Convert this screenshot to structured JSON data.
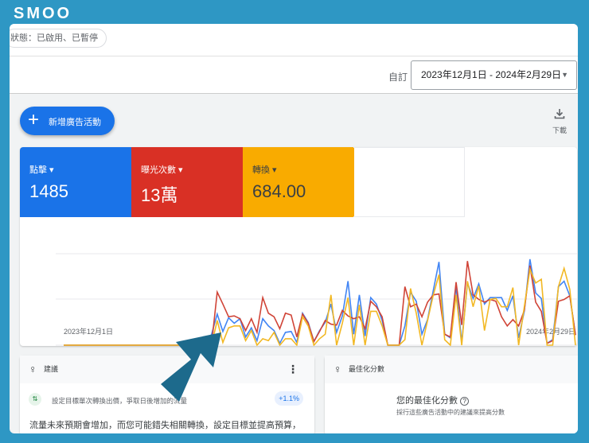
{
  "brand": "SMOO",
  "filter_chip": "狀態：已啟用、已暫停",
  "date": {
    "label": "自訂",
    "range": "2023年12月1日 - 2024年2月29日"
  },
  "new_campaign": "新增廣告活動",
  "download": "下載",
  "metrics": [
    {
      "name": "點擊",
      "value": "1485",
      "color": "#1a73e8"
    },
    {
      "name": "曝光次數",
      "value": "13萬",
      "color": "#d93025"
    },
    {
      "name": "轉換",
      "value": "684.00",
      "color": "#f9ab00"
    }
  ],
  "chart_data": {
    "type": "line",
    "x_start_label": "2023年12月1日",
    "x_end_label": "2024年2月29日",
    "days": 91,
    "ylim": [
      0,
      100
    ],
    "series": [
      {
        "name": "點擊",
        "color": "#4285f4",
        "values": [
          0,
          0,
          0,
          0,
          0,
          0,
          0,
          0,
          0,
          0,
          0,
          0,
          0,
          0,
          0,
          0,
          0,
          0,
          0,
          0,
          0,
          0,
          0,
          0,
          0,
          0,
          12,
          34,
          15,
          30,
          24,
          29,
          9,
          19,
          5,
          29,
          21,
          16,
          2,
          14,
          15,
          3,
          35,
          25,
          4,
          16,
          25,
          45,
          14,
          32,
          70,
          12,
          55,
          10,
          52,
          45,
          27,
          0,
          0,
          0,
          21,
          58,
          48,
          12,
          28,
          60,
          91,
          12,
          8,
          64,
          3,
          68,
          51,
          67,
          45,
          52,
          52,
          52,
          38,
          54,
          8,
          37,
          94,
          57,
          51,
          2,
          6,
          64,
          70,
          54,
          11
        ]
      },
      {
        "name": "曝光次數",
        "color": "#d04437",
        "values": [
          0,
          0,
          0,
          0,
          0,
          0,
          0,
          0,
          0,
          0,
          0,
          0,
          0,
          0,
          0,
          0,
          0,
          0,
          0,
          0,
          0,
          0,
          0,
          0,
          0,
          0,
          1,
          58,
          45,
          31,
          32,
          29,
          16,
          29,
          14,
          52,
          35,
          31,
          18,
          35,
          33,
          9,
          34,
          24,
          4,
          15,
          27,
          23,
          22,
          38,
          32,
          29,
          31,
          18,
          48,
          42,
          31,
          0,
          0,
          0,
          64,
          42,
          45,
          31,
          47,
          55,
          56,
          12,
          9,
          69,
          22,
          92,
          55,
          50,
          47,
          50,
          48,
          31,
          21,
          28,
          21,
          38,
          87,
          47,
          37,
          2,
          5,
          48,
          50,
          54,
          11
        ]
      },
      {
        "name": "轉換",
        "color": "#f2b824",
        "values": [
          0,
          0,
          0,
          0,
          0,
          0,
          0,
          0,
          0,
          0,
          0,
          0,
          0,
          0,
          0,
          0,
          0,
          0,
          0,
          0,
          0,
          0,
          0,
          0,
          0,
          0,
          0,
          27,
          3,
          19,
          21,
          21,
          5,
          16,
          0,
          7,
          5,
          14,
          0,
          7,
          7,
          0,
          31,
          21,
          0,
          7,
          12,
          55,
          0,
          24,
          52,
          0,
          44,
          0,
          37,
          37,
          21,
          0,
          0,
          0,
          6,
          62,
          35,
          0,
          27,
          55,
          77,
          6,
          0,
          55,
          0,
          70,
          42,
          65,
          16,
          50,
          51,
          42,
          42,
          63,
          0,
          42,
          83,
          68,
          72,
          0,
          0,
          64,
          84,
          61,
          0
        ]
      }
    ]
  },
  "recommendations": {
    "title": "建議",
    "item": "設定目標單次轉換出價，爭取日後增加的流量",
    "badge": "+1.1%",
    "body": "流量未來預期會增加，而您可能錯失相關轉換，設定目標並提高預算，"
  },
  "optimization": {
    "title": "最佳化分數",
    "heading": "您的最佳化分數",
    "help": "?",
    "sub": "採行這些廣告活動中的建議來提高分數"
  }
}
